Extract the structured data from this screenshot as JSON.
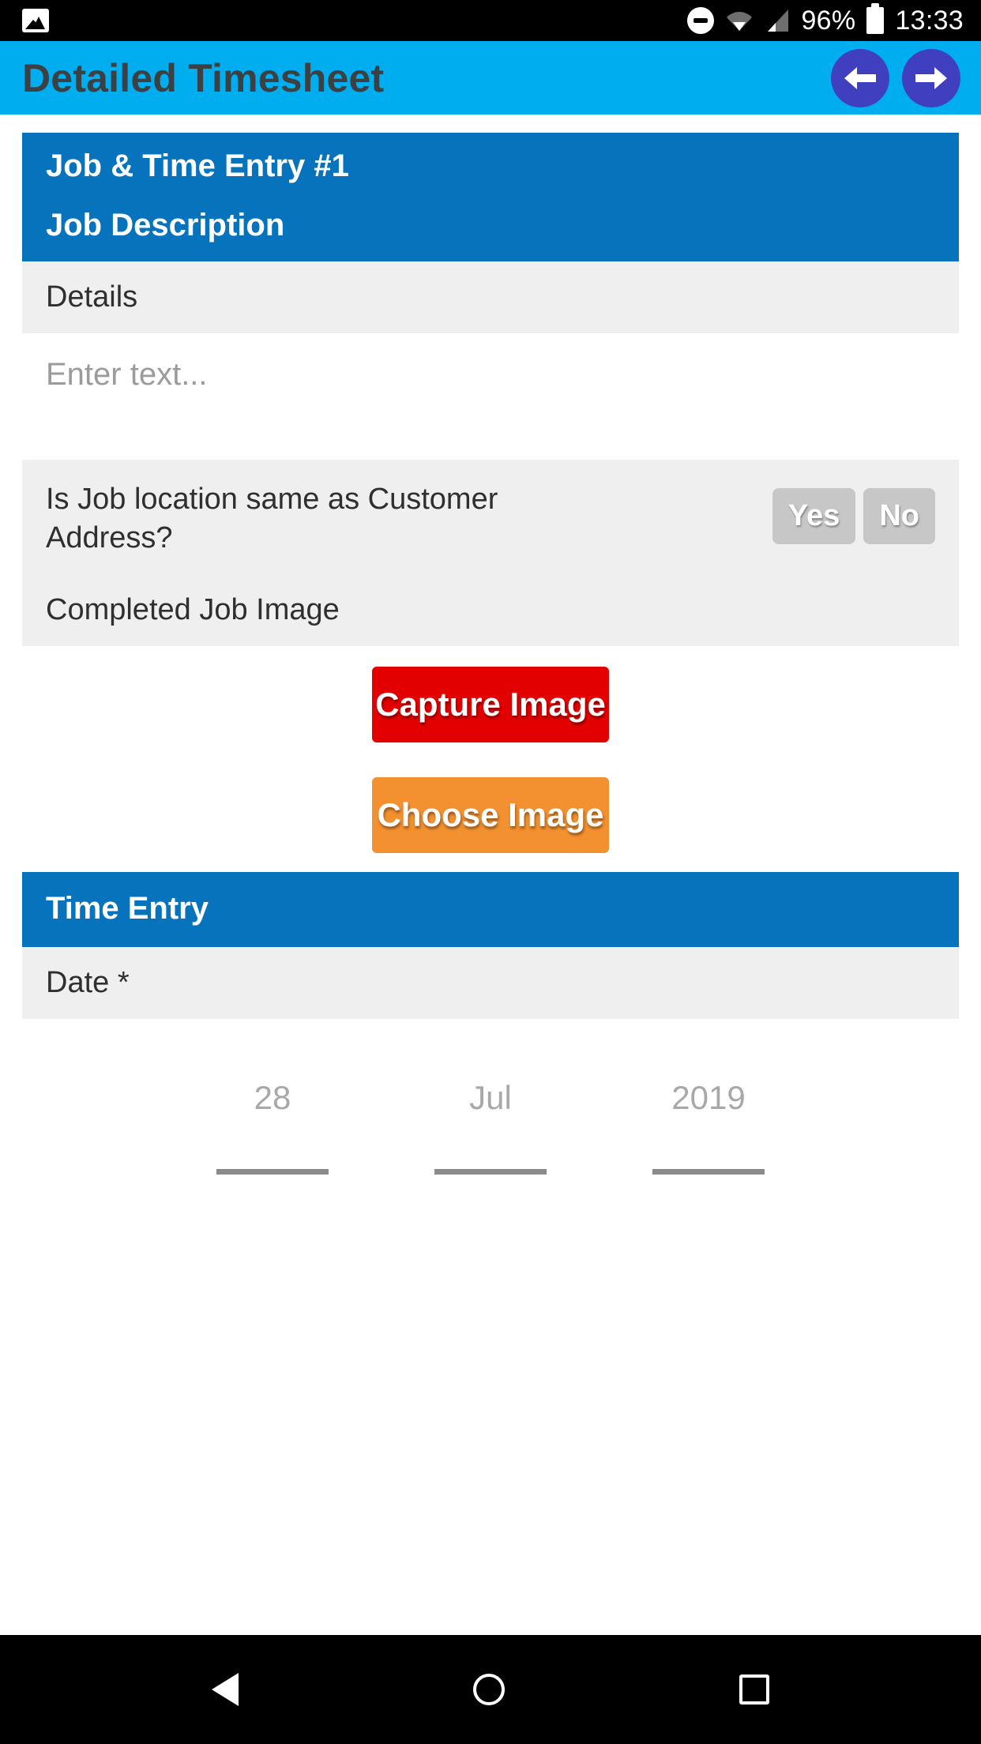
{
  "status_bar": {
    "photo_icon": "image-icon",
    "dnd_icon": "do-not-disturb-icon",
    "wifi_icon": "wifi-icon",
    "signal_icon": "cellular-signal-icon",
    "battery_percent": "96%",
    "battery_icon": "battery-icon",
    "time": "13:33"
  },
  "app_bar": {
    "title": "Detailed Timesheet",
    "back_icon": "arrow-left-icon",
    "forward_icon": "arrow-right-icon",
    "background_color": "#00AEEF",
    "button_color": "#3F3FBF"
  },
  "card": {
    "header": {
      "entry_title": "Job & Time Entry #1",
      "section_title": "Job Description",
      "background_color": "#0873BD"
    },
    "details": {
      "label": "Details",
      "input_placeholder": "Enter text..."
    },
    "location_question": {
      "text": "Is Job location same as Customer Address?",
      "yes_label": "Yes",
      "no_label": "No"
    },
    "completed_job_image": {
      "label": "Completed Job Image",
      "capture_label": "Capture Image",
      "choose_label": "Choose Image",
      "capture_color": "#E30000",
      "choose_color": "#F3902F"
    },
    "time_entry": {
      "section_title": "Time Entry",
      "date_label": "Date *",
      "date": {
        "day": "28",
        "month": "Jul",
        "year": "2019"
      }
    }
  },
  "system_nav": {
    "back_icon": "triangle-back-icon",
    "home_icon": "circle-home-icon",
    "recents_icon": "square-recents-icon"
  }
}
